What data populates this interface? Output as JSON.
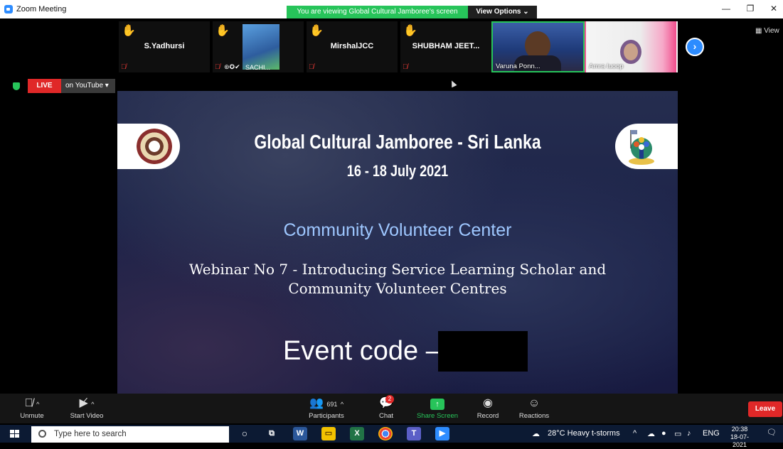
{
  "window": {
    "title": "Zoom Meeting"
  },
  "banner": {
    "viewing_text": "You are viewing Global Cultural Jamboree's screen",
    "view_options_label": "View Options ⌄"
  },
  "gallery": {
    "thumbs": [
      {
        "name": "S.Yadhursi"
      },
      {
        "name": "SACHI...",
        "badges": "⊛✪✔"
      },
      {
        "name": "MirshalJCC"
      },
      {
        "name": "SHUBHAM  JEET..."
      }
    ],
    "videos": [
      {
        "name": "Varuna Ponn..."
      },
      {
        "name": "Amra luoop"
      }
    ],
    "next_label": "›",
    "view_label": "View"
  },
  "live": {
    "badge": "LIVE",
    "platform": "on YouTube ▾"
  },
  "slide": {
    "title": "Global Cultural Jamboree - Sri Lanka",
    "dates": "16 - 18 July 2021",
    "subtitle": "Community Volunteer Center",
    "webinar_line1": "Webinar No 7 - Introducing Service Learning Scholar and",
    "webinar_line2": "Community Volunteer Centres",
    "event_code": "Event code –"
  },
  "toolbar": {
    "unmute": "Unmute",
    "start_video": "Start Video",
    "participants": "Participants",
    "participant_count": "691",
    "chat": "Chat",
    "chat_badge": "2",
    "share_screen": "Share Screen",
    "record": "Record",
    "reactions": "Reactions",
    "leave": "Leave"
  },
  "taskbar": {
    "search_placeholder": "Type here to search",
    "weather": "28°C  Heavy t-storms",
    "language": "ENG",
    "time": "20:38",
    "date": "18-07-2021"
  }
}
